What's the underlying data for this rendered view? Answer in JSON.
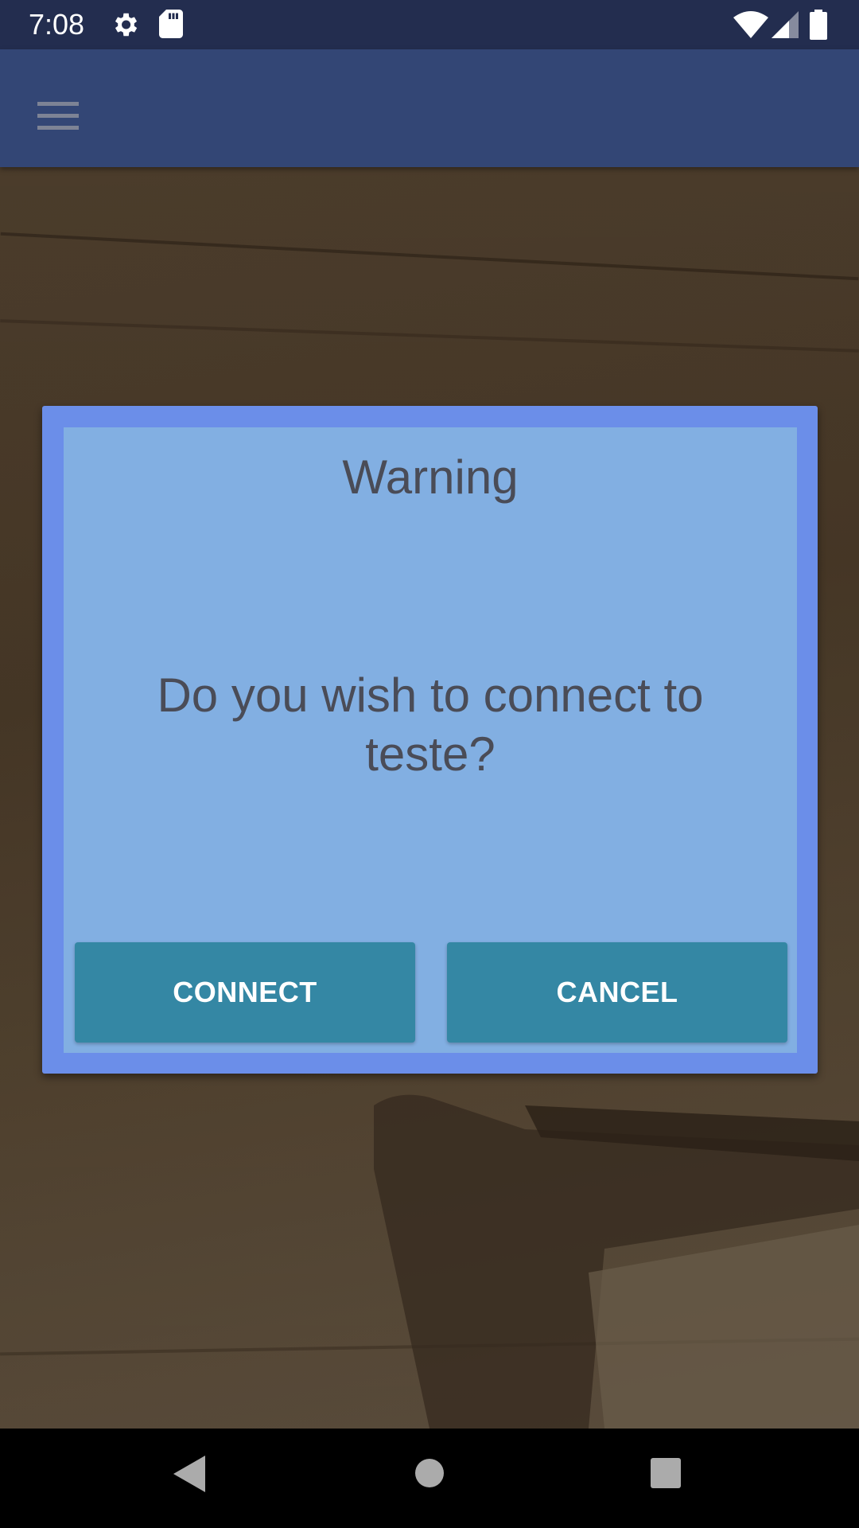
{
  "status_bar": {
    "time": "7:08",
    "left_icons": [
      "settings-icon",
      "sd-card-icon"
    ],
    "right_icons": [
      "wifi-icon",
      "cell-signal-icon",
      "battery-icon"
    ]
  },
  "app_bar": {
    "menu_icon": "hamburger-menu-icon"
  },
  "dialog": {
    "title": "Warning",
    "message": "Do you wish to connect to teste?",
    "buttons": {
      "connect": "CONNECT",
      "cancel": "CANCEL"
    }
  },
  "nav_bar": {
    "icons": [
      "back-icon",
      "home-icon",
      "recents-icon"
    ]
  },
  "colors": {
    "status_bar": "#232d4f",
    "app_bar": "#334675",
    "dialog_border": "#6b8ee9",
    "dialog_background": "#82afe2",
    "button": "#3487a4",
    "dialog_text": "#4a4c57"
  }
}
